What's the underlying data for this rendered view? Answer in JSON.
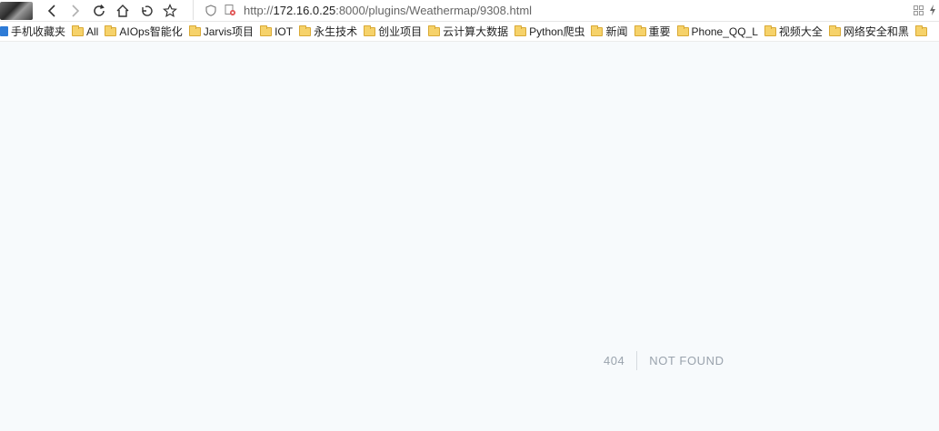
{
  "browser": {
    "url_scheme": "http://",
    "url_host": "172.16.0.25",
    "url_rest": ":8000/plugins/Weathermap/9308.html"
  },
  "bookmarks": [
    {
      "label": "手机收藏夹",
      "icon": "mobile-bookmarks-icon"
    },
    {
      "label": "All",
      "icon": "folder-icon"
    },
    {
      "label": "AIOps智能化",
      "icon": "folder-icon"
    },
    {
      "label": "Jarvis项目",
      "icon": "folder-icon"
    },
    {
      "label": "IOT",
      "icon": "folder-icon"
    },
    {
      "label": "永生技术",
      "icon": "folder-icon"
    },
    {
      "label": "创业项目",
      "icon": "folder-icon"
    },
    {
      "label": "云计算大数据",
      "icon": "folder-icon"
    },
    {
      "label": "Python爬虫",
      "icon": "folder-icon"
    },
    {
      "label": "新闻",
      "icon": "folder-icon"
    },
    {
      "label": "重要",
      "icon": "folder-icon"
    },
    {
      "label": "Phone_QQ_L",
      "icon": "folder-icon"
    },
    {
      "label": "视频大全",
      "icon": "folder-icon"
    },
    {
      "label": "网络安全和黑",
      "icon": "folder-icon"
    }
  ],
  "error": {
    "code": "404",
    "message": "NOT FOUND"
  }
}
